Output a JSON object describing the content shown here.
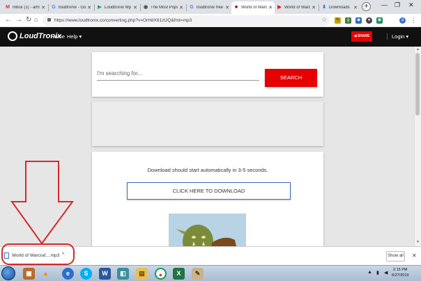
{
  "browser": {
    "tabs": [
      {
        "icon": "gmail-icon",
        "title": "Inbox (1) - ams",
        "icon_char": "M",
        "icon_color": "#d93025"
      },
      {
        "icon": "google-icon",
        "title": "loudtronix - Go",
        "icon_char": "G",
        "icon_color": "#4285f4"
      },
      {
        "icon": "play-icon",
        "title": "Loudtronix Mp",
        "icon_char": "▶",
        "icon_color": "#2aa35a"
      },
      {
        "icon": "globe-icon",
        "title": "The Most Popu",
        "icon_char": "◉",
        "icon_color": "#444"
      },
      {
        "icon": "google-icon",
        "title": "loudtronix free",
        "icon_char": "G",
        "icon_color": "#4285f4"
      },
      {
        "icon": "game-icon",
        "title": "World of Warcr",
        "icon_char": "■",
        "icon_color": "#7a1a1a"
      },
      {
        "icon": "youtube-icon",
        "title": "World of Warcr",
        "icon_char": "▶",
        "icon_color": "#ff0000"
      },
      {
        "icon": "download-icon",
        "title": "Downloads",
        "icon_char": "⬇",
        "icon_color": "#1a73e8"
      }
    ],
    "address": "https://www.loudtronix.co/converting.php?v=OrHdX81ztJQ&fmt=mp3"
  },
  "site": {
    "logo_text": "LoudTronix",
    "nav": {
      "home": "Home",
      "help": "Help ▾"
    },
    "share_label": "◀ SHARE",
    "login_label": "Login ▾"
  },
  "search": {
    "placeholder": "I'm searching for...",
    "button_label": "SEARCH"
  },
  "download": {
    "message": "Download should start automatically in 3-5 seconds.",
    "button_label": "CLICK HERE TO DOWNLOAD"
  },
  "download_bar": {
    "filename": "World of Warcraf....mp3",
    "show_all": "Show all"
  },
  "taskbar": {
    "time": "2:15 PM",
    "date": "6/27/2019"
  },
  "colors": {
    "accent_red": "#e60000",
    "header_bg": "#111111",
    "annotation_red": "#d42a2a"
  }
}
